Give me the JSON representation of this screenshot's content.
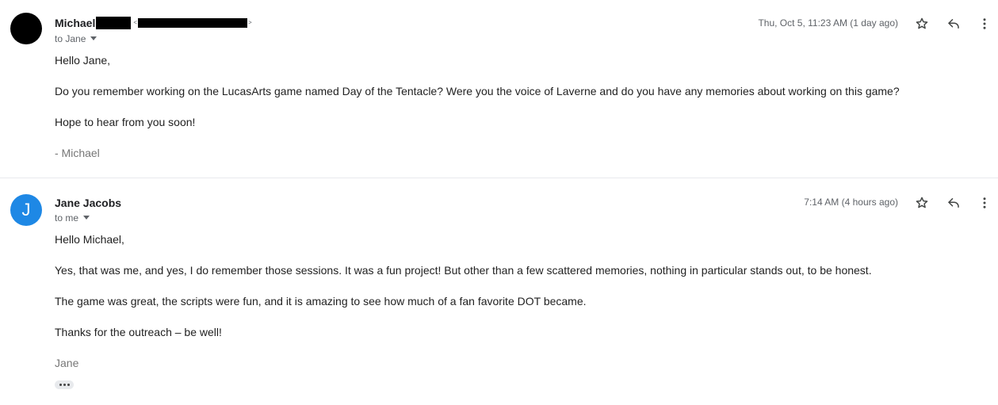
{
  "messages": [
    {
      "sender_name": "Michael",
      "email_open": "<",
      "email_close": ">",
      "to": "to Jane",
      "date": "Thu, Oct 5, 11:23 AM (1 day ago)",
      "body": [
        "Hello Jane,",
        "Do you remember working on the LucasArts game named Day of the Tentacle? Were you the voice of Laverne and do you have any memories about working on this game?",
        "Hope to hear from you soon!"
      ],
      "signature": "- Michael"
    },
    {
      "avatar_letter": "J",
      "avatar_color": "#1e88e5",
      "sender_name": "Jane Jacobs",
      "to": "to me",
      "date": "7:14 AM (4 hours ago)",
      "body": [
        "Hello Michael,",
        "Yes, that was me, and yes, I do remember those sessions. It was a fun project! But other than a few scattered memories, nothing in particular stands out, to be honest.",
        "The game was great, the scripts were fun, and it is amazing to see how much of a fan favorite DOT became.",
        "Thanks for the outreach – be well!"
      ],
      "signature": "Jane"
    }
  ],
  "icons": {
    "star": "star-outline-icon",
    "reply": "reply-arrow-icon",
    "more": "more-vertical-icon",
    "trimmed": "ellipsis-icon"
  }
}
